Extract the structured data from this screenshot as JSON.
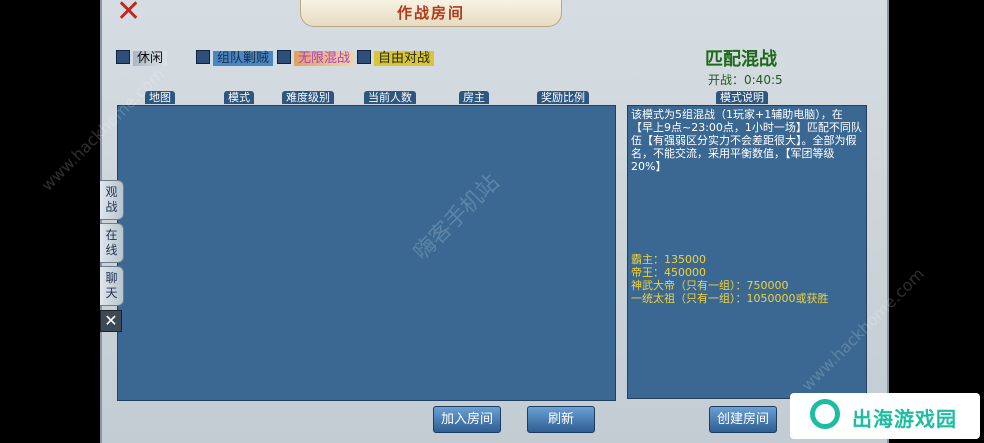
{
  "window": {
    "title": "作战房间",
    "close_icon": "close-x-icon"
  },
  "modes": [
    {
      "label": "休闲",
      "selected": false
    },
    {
      "label": "组队剿贼",
      "selected": false
    },
    {
      "label": "无限混战",
      "selected": false
    },
    {
      "label": "自由对战",
      "selected": false
    }
  ],
  "match": {
    "title": "匹配混战",
    "countdown": "开战：0:40:5"
  },
  "room_table": {
    "columns": [
      "地图",
      "模式",
      "难度级别",
      "当前人数",
      "房主",
      "奖励比例"
    ],
    "rows": []
  },
  "description": {
    "header": "模式说明",
    "text": "该模式为5组混战（1玩家+1辅助电脑），在【早上9点~23:00点，1小时一场】匹配不同队伍【有强弱区分实力不会差距很大】。全部为假名，不能交流，采用平衡数值，【军团等级20%】",
    "rewards": [
      "霸主：135000",
      "帝王：450000",
      "神武大帝（只有一组）：750000",
      "一统太祖（只有一组）：1050000或获胜"
    ]
  },
  "side_tabs": [
    "观战",
    "在线",
    "聊天"
  ],
  "buttons": {
    "join": "加入房间",
    "refresh": "刷新",
    "create": "创建房间"
  },
  "watermarks": {
    "center": "嗨客手机站",
    "url": "www.hackhome.com",
    "logo_text": "出海游戏园"
  }
}
